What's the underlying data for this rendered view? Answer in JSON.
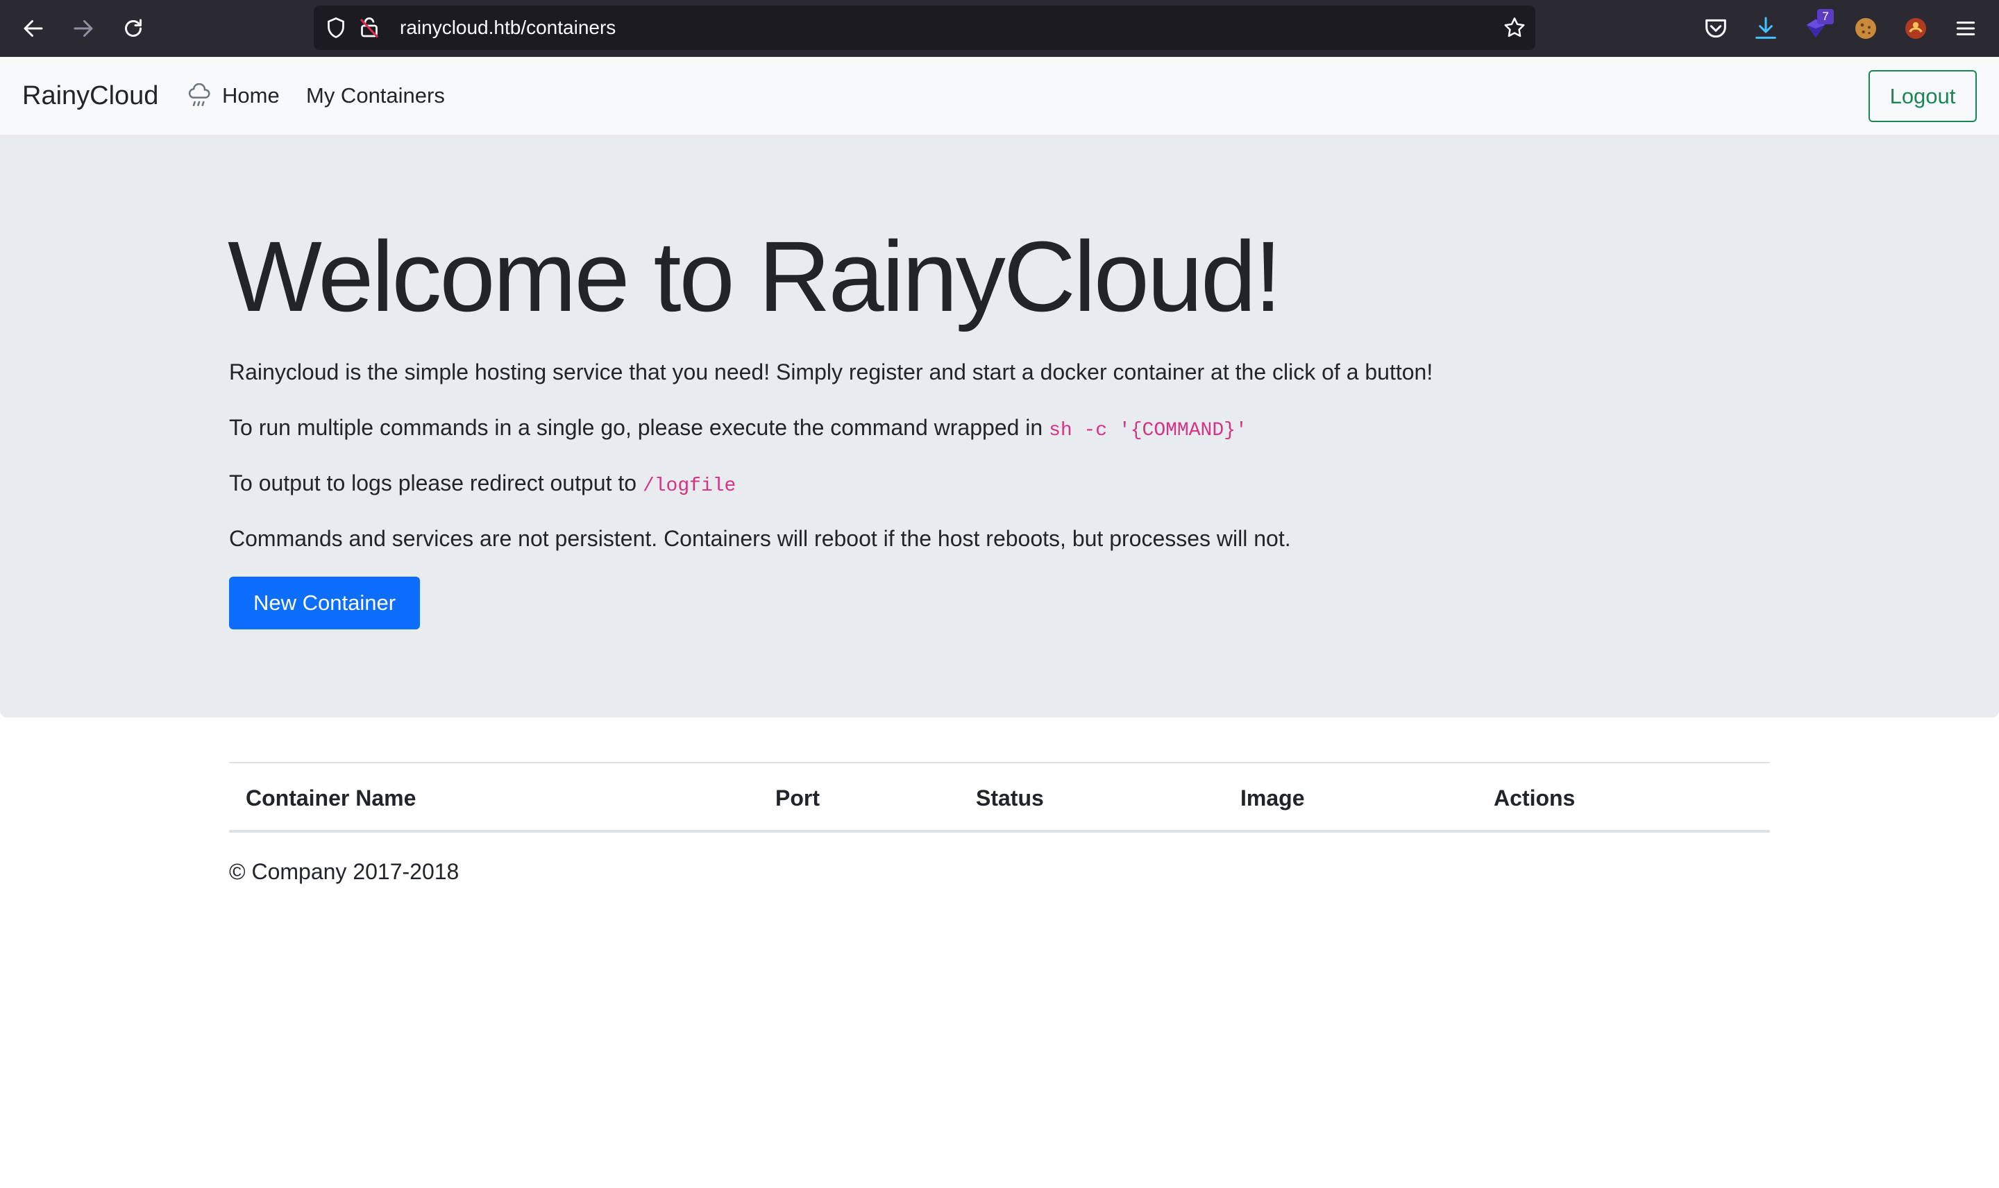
{
  "browser": {
    "url": "rainycloud.htb/containers",
    "extension_badge": "7"
  },
  "navbar": {
    "brand": "RainyCloud",
    "links": [
      "Home",
      "My Containers"
    ],
    "logout_label": "Logout"
  },
  "hero": {
    "title": "Welcome to RainyCloud!",
    "line1": "Rainycloud is the simple hosting service that you need! Simply register and start a docker container at the click of a button!",
    "line2_text": "To run multiple commands in a single go, please execute the command wrapped in ",
    "line2_code": "sh -c '{COMMAND}'",
    "line3_text": "To output to logs please redirect output to ",
    "line3_code": "/logfile",
    "line4": "Commands and services are not persistent. Containers will reboot if the host reboots, but processes will not.",
    "button_label": "New Container"
  },
  "table": {
    "columns": [
      "Container Name",
      "Port",
      "Status",
      "Image",
      "Actions"
    ],
    "rows": []
  },
  "footer": {
    "text": "© Company 2017-2018"
  },
  "colors": {
    "primary": "#0d6efd",
    "success": "#198754",
    "code": "#d63384",
    "jumbotron_bg": "#e9ecef",
    "browser_bg": "#2b2a33"
  }
}
